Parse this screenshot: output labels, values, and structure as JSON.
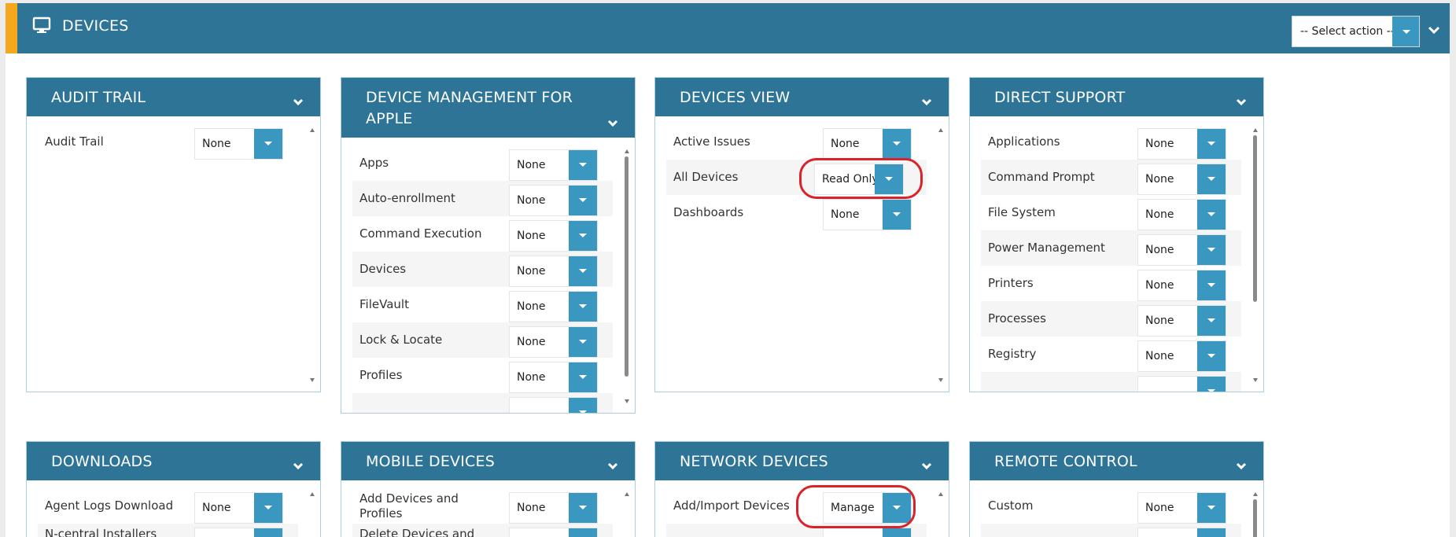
{
  "header": {
    "title": "DEVICES",
    "action_select": "-- Select action --"
  },
  "panels": {
    "audit_trail": {
      "title": "AUDIT TRAIL",
      "rows": [
        {
          "label": "Audit Trail",
          "value": "None"
        }
      ]
    },
    "device_mgmt_apple": {
      "title": "DEVICE MANAGEMENT FOR APPLE",
      "rows": [
        {
          "label": "Apps",
          "value": "None"
        },
        {
          "label": "Auto-enrollment",
          "value": "None"
        },
        {
          "label": "Command Execution",
          "value": "None"
        },
        {
          "label": "Devices",
          "value": "None"
        },
        {
          "label": "FileVault",
          "value": "None"
        },
        {
          "label": "Lock & Locate",
          "value": "None"
        },
        {
          "label": "Profiles",
          "value": "None"
        }
      ]
    },
    "devices_view": {
      "title": "DEVICES VIEW",
      "rows": [
        {
          "label": "Active Issues",
          "value": "None"
        },
        {
          "label": "All Devices",
          "value": "Read Only"
        },
        {
          "label": "Dashboards",
          "value": "None"
        }
      ]
    },
    "direct_support": {
      "title": "DIRECT SUPPORT",
      "rows": [
        {
          "label": "Applications",
          "value": "None"
        },
        {
          "label": "Command Prompt",
          "value": "None"
        },
        {
          "label": "File System",
          "value": "None"
        },
        {
          "label": "Power Management",
          "value": "None"
        },
        {
          "label": "Printers",
          "value": "None"
        },
        {
          "label": "Processes",
          "value": "None"
        },
        {
          "label": "Registry",
          "value": "None"
        }
      ]
    },
    "downloads": {
      "title": "DOWNLOADS",
      "rows": [
        {
          "label": "Agent Logs Download",
          "value": "None"
        },
        {
          "label": "N-central Installers",
          "value": ""
        }
      ]
    },
    "mobile_devices": {
      "title": "MOBILE DEVICES",
      "rows": [
        {
          "label": "Add Devices and Profiles",
          "value": "None"
        },
        {
          "label": "Delete Devices and",
          "value": ""
        }
      ]
    },
    "network_devices": {
      "title": "NETWORK DEVICES",
      "rows": [
        {
          "label": "Add/Import Devices",
          "value": "Manage"
        }
      ]
    },
    "remote_control": {
      "title": "REMOTE CONTROL",
      "rows": [
        {
          "label": "Custom",
          "value": "None"
        }
      ]
    }
  },
  "colors": {
    "header": "#2e7497",
    "accent": "#f5a81c",
    "dropdown": "#3a97c0",
    "highlight": "#d9232a"
  },
  "icons": {
    "header": "monitor-icon",
    "collapse": "chevron-down-icon"
  }
}
